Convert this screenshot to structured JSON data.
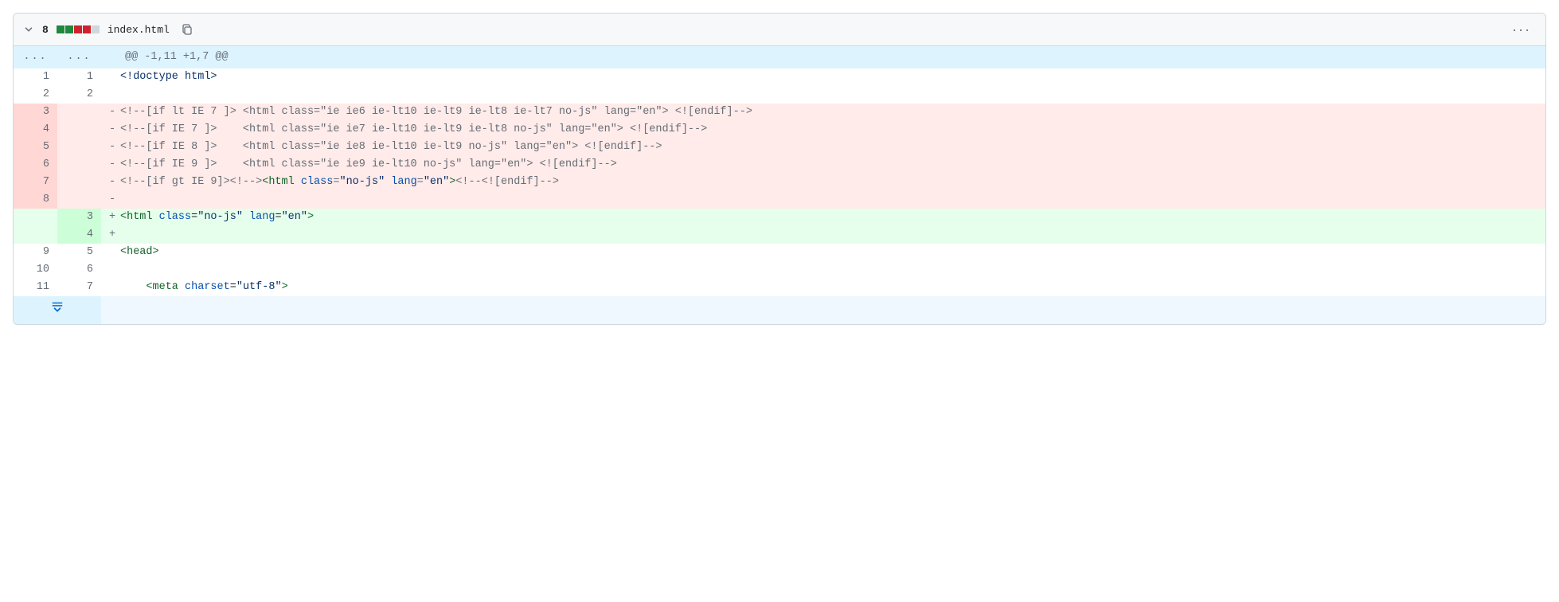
{
  "header": {
    "change_count": "8",
    "filename": "index.html",
    "diffstat_blocks": [
      "add",
      "add",
      "del",
      "del",
      "neu"
    ],
    "kebab_label": "···"
  },
  "hunk": "@@ -1,11 +1,7 @@",
  "lines": [
    {
      "type": "ctx",
      "old": "1",
      "new": "1",
      "marker": " ",
      "segs": [
        {
          "t": "<!doctype html>",
          "c": "c-doctype"
        }
      ]
    },
    {
      "type": "ctx",
      "old": "2",
      "new": "2",
      "marker": " ",
      "segs": [
        {
          "t": "",
          "c": ""
        }
      ]
    },
    {
      "type": "del",
      "old": "3",
      "new": "",
      "marker": "-",
      "segs": [
        {
          "t": "<!--[if lt IE 7 ]> <html class=\"ie ie6 ie-lt10 ie-lt9 ie-lt8 ie-lt7 no-js\" lang=\"en\"> <![endif]-->",
          "c": "c-comment"
        }
      ]
    },
    {
      "type": "del",
      "old": "4",
      "new": "",
      "marker": "-",
      "segs": [
        {
          "t": "<!--[if IE 7 ]>    <html class=\"ie ie7 ie-lt10 ie-lt9 ie-lt8 no-js\" lang=\"en\"> <![endif]-->",
          "c": "c-comment"
        }
      ]
    },
    {
      "type": "del",
      "old": "5",
      "new": "",
      "marker": "-",
      "segs": [
        {
          "t": "<!--[if IE 8 ]>    <html class=\"ie ie8 ie-lt10 ie-lt9 no-js\" lang=\"en\"> <![endif]-->",
          "c": "c-comment"
        }
      ]
    },
    {
      "type": "del",
      "old": "6",
      "new": "",
      "marker": "-",
      "segs": [
        {
          "t": "<!--[if IE 9 ]>    <html class=\"ie ie9 ie-lt10 no-js\" lang=\"en\"> <![endif]-->",
          "c": "c-comment"
        }
      ]
    },
    {
      "type": "del",
      "old": "7",
      "new": "",
      "marker": "-",
      "segs": [
        {
          "t": "<!--[if gt IE 9]><!-->",
          "c": "c-comment"
        },
        {
          "t": "<html ",
          "c": "c-tag"
        },
        {
          "t": "class",
          "c": "c-attr"
        },
        {
          "t": "=",
          "c": ""
        },
        {
          "t": "\"no-js\"",
          "c": "c-str"
        },
        {
          "t": " ",
          "c": ""
        },
        {
          "t": "lang",
          "c": "c-attr"
        },
        {
          "t": "=",
          "c": ""
        },
        {
          "t": "\"en\"",
          "c": "c-str"
        },
        {
          "t": ">",
          "c": "c-tag"
        },
        {
          "t": "<!--<![endif]-->",
          "c": "c-comment"
        }
      ]
    },
    {
      "type": "del",
      "old": "8",
      "new": "",
      "marker": "-",
      "segs": [
        {
          "t": "",
          "c": ""
        }
      ]
    },
    {
      "type": "add",
      "old": "",
      "new": "3",
      "marker": "+",
      "segs": [
        {
          "t": "<html ",
          "c": "c-tag"
        },
        {
          "t": "class",
          "c": "c-attr"
        },
        {
          "t": "=",
          "c": ""
        },
        {
          "t": "\"no-js\"",
          "c": "c-str"
        },
        {
          "t": " ",
          "c": ""
        },
        {
          "t": "lang",
          "c": "c-attr"
        },
        {
          "t": "=",
          "c": ""
        },
        {
          "t": "\"en\"",
          "c": "c-str"
        },
        {
          "t": ">",
          "c": "c-tag"
        }
      ]
    },
    {
      "type": "add",
      "old": "",
      "new": "4",
      "marker": "+",
      "segs": [
        {
          "t": "",
          "c": ""
        }
      ]
    },
    {
      "type": "ctx",
      "old": "9",
      "new": "5",
      "marker": " ",
      "segs": [
        {
          "t": "<head>",
          "c": "c-tag"
        }
      ]
    },
    {
      "type": "ctx",
      "old": "10",
      "new": "6",
      "marker": " ",
      "segs": [
        {
          "t": "",
          "c": ""
        }
      ]
    },
    {
      "type": "ctx",
      "old": "11",
      "new": "7",
      "marker": " ",
      "segs": [
        {
          "t": "    ",
          "c": ""
        },
        {
          "t": "<meta ",
          "c": "c-tag"
        },
        {
          "t": "charset",
          "c": "c-attr"
        },
        {
          "t": "=",
          "c": ""
        },
        {
          "t": "\"utf-8\"",
          "c": "c-str"
        },
        {
          "t": ">",
          "c": "c-tag"
        }
      ]
    }
  ]
}
